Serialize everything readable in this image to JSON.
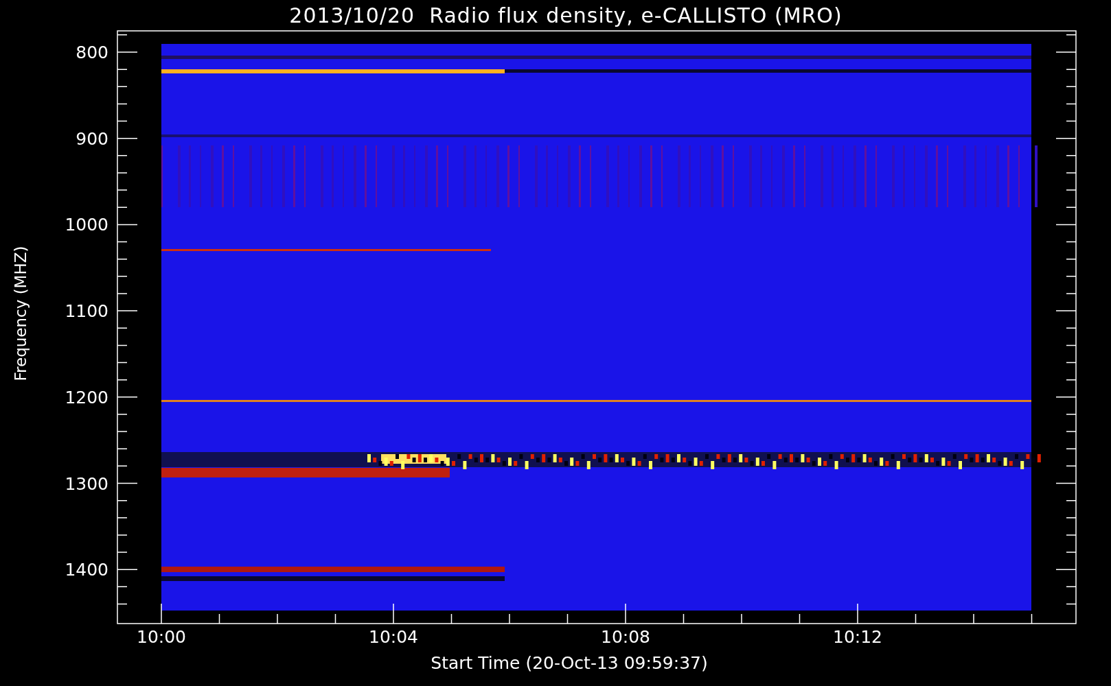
{
  "title": "2013/10/20  Radio flux density, e-CALLISTO (MRO)",
  "y_axis": {
    "label": "Frequency (MHZ)",
    "ticks": [
      "800",
      "900",
      "1000",
      "1100",
      "1200",
      "1300",
      "1400"
    ]
  },
  "x_axis": {
    "label": "Start Time (20-Oct-13 09:59:37)",
    "ticks": [
      "10:00",
      "10:04",
      "10:08",
      "10:12"
    ]
  }
}
